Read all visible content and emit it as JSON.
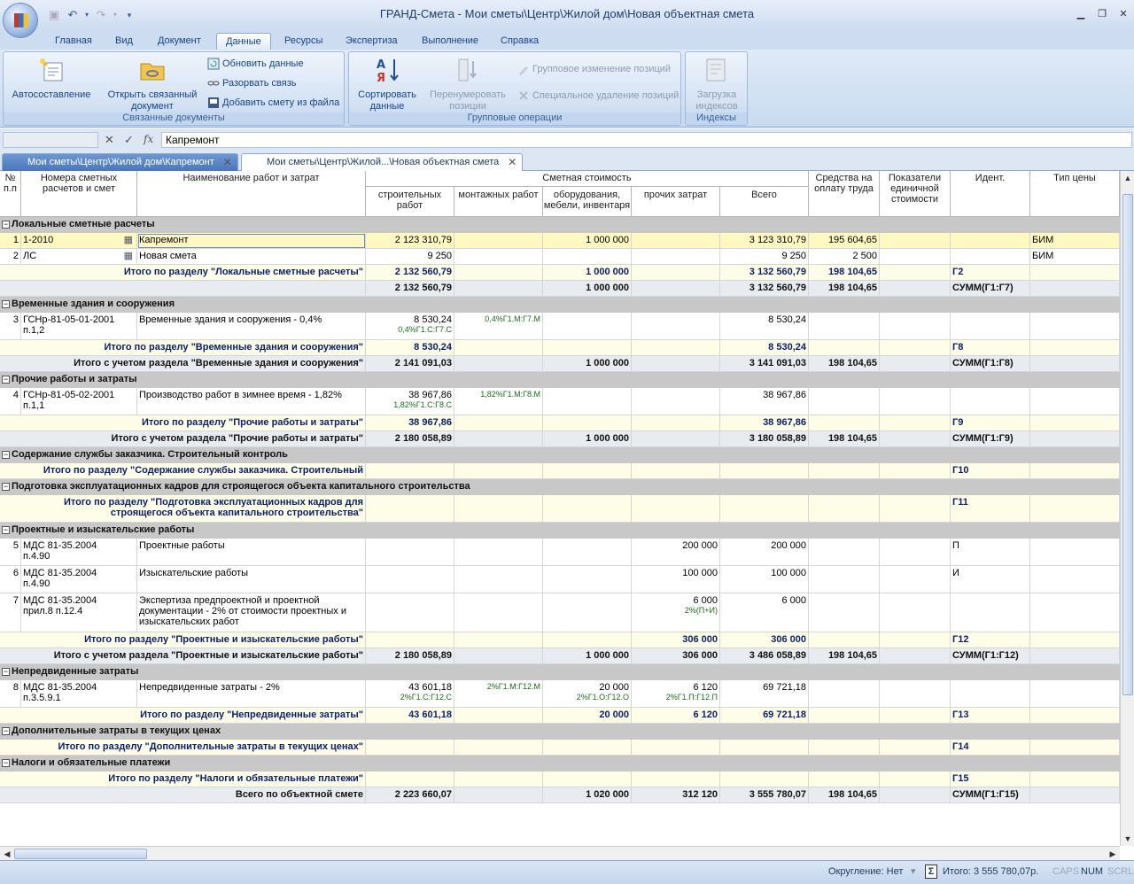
{
  "window": {
    "title": "ГРАНД-Смета - Мои сметы\\Центр\\Жилой дом\\Новая объектная смета"
  },
  "ribbon_tabs": [
    "Главная",
    "Вид",
    "Документ",
    "Данные",
    "Ресурсы",
    "Экспертиза",
    "Выполнение",
    "Справка"
  ],
  "ribbon": {
    "linked": {
      "autocompose": "Автосоставление",
      "open_linked": "Открыть связанный документ",
      "refresh": "Обновить данные",
      "break_link": "Разорвать связь",
      "add_from_file": "Добавить смету из файла",
      "group": "Связанные документы"
    },
    "group_ops": {
      "sort": "Сортировать данные",
      "renumber": "Перенумеровать позиции",
      "group_change": "Групповое изменение позиций",
      "special_delete": "Специальное удаление позиций",
      "group": "Групповые операции"
    },
    "indexes": {
      "load": "Загрузка индексов",
      "group": "Индексы"
    }
  },
  "formula_bar": {
    "name": "",
    "value": "Капремонт"
  },
  "doc_tabs": [
    {
      "label": "Мои сметы\\Центр\\Жилой дом\\Капремонт",
      "active": false
    },
    {
      "label": "Мои сметы\\Центр\\Жилой...\\Новая объектная смета",
      "active": true
    }
  ],
  "headers": {
    "num": "№ п.п",
    "codes": "Номера сметных расчетов и смет",
    "name": "Наименование работ и затрат",
    "cost": "Сметная стоимость",
    "build": "строительных работ",
    "mount": "монтажных работ",
    "equip": "оборудования, мебели, инвентаря",
    "other": "прочих затрат",
    "total": "Всего",
    "labor": "Средства на оплату труда",
    "unit": "Показатели единичной стоимости",
    "ident": "Идент.",
    "price_type": "Тип цены"
  },
  "rows": [
    {
      "kind": "sec",
      "label": "Локальные сметные расчеты"
    },
    {
      "kind": "item",
      "sel": true,
      "num": "1",
      "code": "1-2010",
      "doc": true,
      "name": "Капремонт",
      "build": "2 123 310,79",
      "equip": "1 000 000",
      "total": "3 123 310,79",
      "labor": "195 604,65",
      "ptype": "БИМ"
    },
    {
      "kind": "item",
      "num": "2",
      "code": "ЛС",
      "doc": true,
      "name": "Новая смета",
      "build": "9 250",
      "total": "9 250",
      "labor": "2 500",
      "ptype": "БИМ"
    },
    {
      "kind": "tot",
      "label": "Итого по разделу \"Локальные сметные расчеты\"",
      "build": "2 132 560,79",
      "equip": "1 000 000",
      "total": "3 132 560,79",
      "labor": "198 104,65",
      "ident": "Г2"
    },
    {
      "kind": "tot2",
      "label": "",
      "build": "2 132 560,79",
      "equip": "1 000 000",
      "total": "3 132 560,79",
      "labor": "198 104,65",
      "ident": "СУММ(Г1:Г7)"
    },
    {
      "kind": "sec",
      "label": "Временные здания и сооружения"
    },
    {
      "kind": "item",
      "h": 31,
      "num": "3",
      "code": "ГСНр-81-05-01-2001",
      "code2": "п.1,2",
      "name": "Временные здания и сооружения - 0,4%",
      "build": "8 530,24",
      "build_f": "0,4%Г1.С:Г7.С",
      "mount_f": "0,4%Г1.М:Г7.М",
      "total": "8 530,24"
    },
    {
      "kind": "tot",
      "label": "Итого по разделу \"Временные здания и сооружения\"",
      "build": "8 530,24",
      "total": "8 530,24",
      "ident": "Г8"
    },
    {
      "kind": "tot2",
      "label": "Итого с учетом раздела \"Временные здания и сооружения\"",
      "build": "2 141 091,03",
      "equip": "1 000 000",
      "total": "3 141 091,03",
      "labor": "198 104,65",
      "ident": "СУММ(Г1:Г8)"
    },
    {
      "kind": "sec",
      "label": "Прочие работы и затраты"
    },
    {
      "kind": "item",
      "h": 31,
      "num": "4",
      "code": "ГСНр-81-05-02-2001",
      "code2": "п.1,1",
      "name": "Производство работ в зимнее время - 1,82%",
      "build": "38 967,86",
      "build_f": "1,82%Г1.С:Г8.С",
      "mount_f": "1,82%Г1.М:Г8.М",
      "total": "38 967,86"
    },
    {
      "kind": "tot",
      "label": "Итого по разделу \"Прочие работы и затраты\"",
      "build": "38 967,86",
      "total": "38 967,86",
      "ident": "Г9"
    },
    {
      "kind": "tot2",
      "label": "Итого с учетом раздела \"Прочие работы и затраты\"",
      "build": "2 180 058,89",
      "equip": "1 000 000",
      "total": "3 180 058,89",
      "labor": "198 104,65",
      "ident": "СУММ(Г1:Г9)"
    },
    {
      "kind": "sec",
      "label": "Содержание службы заказчика. Строительный контроль"
    },
    {
      "kind": "tot",
      "label": "Итого по разделу \"Содержание службы заказчика. Строительный",
      "ident": "Г10"
    },
    {
      "kind": "sec",
      "label": "Подготовка эксплуатационных кадров для строящегося объекта капитального строительства"
    },
    {
      "kind": "tot",
      "h": 31,
      "label": "Итого по разделу \"Подготовка эксплуатационных кадров для",
      "label2": "строящегося объекта капитального строительства\"",
      "ident": "Г11"
    },
    {
      "kind": "sec",
      "label": "Проектные и изыскательские работы"
    },
    {
      "kind": "item",
      "h": 31,
      "num": "5",
      "code": "МДС 81-35.2004",
      "code2": "п.4.90",
      "name": "Проектные работы",
      "other": "200 000",
      "total": "200 000",
      "ident": "П"
    },
    {
      "kind": "item",
      "h": 31,
      "num": "6",
      "code": "МДС 81-35.2004",
      "code2": "п.4.90",
      "name": "Изыскательские работы",
      "other": "100 000",
      "total": "100 000",
      "ident": "И"
    },
    {
      "kind": "item",
      "h": 44,
      "num": "7",
      "code": "МДС 81-35.2004",
      "code2": "прил.8 п.12.4",
      "name": "Экспертиза предпроектной и проектной",
      "name2": "документации - 2% от стоимости проектных и",
      "name3": "изыскательских работ",
      "other": "6 000",
      "other_f": "2%(П+И)",
      "total": "6 000"
    },
    {
      "kind": "tot",
      "label": "Итого по разделу \"Проектные и изыскательские работы\"",
      "other": "306 000",
      "total": "306 000",
      "ident": "Г12"
    },
    {
      "kind": "tot2",
      "label": "Итого с учетом раздела \"Проектные и изыскательские работы\"",
      "build": "2 180 058,89",
      "equip": "1 000 000",
      "other": "306 000",
      "total": "3 486 058,89",
      "labor": "198 104,65",
      "ident": "СУММ(Г1:Г12)"
    },
    {
      "kind": "sec",
      "label": "Непредвиденные затраты"
    },
    {
      "kind": "item",
      "h": 31,
      "num": "8",
      "code": "МДС 81-35.2004",
      "code2": "п.3.5.9.1",
      "name": "Непредвиденные затраты - 2%",
      "build": "43 601,18",
      "build_f": "2%Г1.С:Г12.С",
      "mount_f": "2%Г1.М:Г12.М",
      "equip": "20 000",
      "equip_f": "2%Г1.О:Г12.О",
      "other": "6 120",
      "other_f": "2%Г1.П:Г12.П",
      "total": "69 721,18"
    },
    {
      "kind": "tot",
      "label": "Итого по разделу \"Непредвиденные затраты\"",
      "build": "43 601,18",
      "equip": "20 000",
      "other": "6 120",
      "total": "69 721,18",
      "ident": "Г13"
    },
    {
      "kind": "sec",
      "label": "Дополнительные затраты в текущих ценах"
    },
    {
      "kind": "tot",
      "label": "Итого по разделу \"Дополнительные затраты в текущих ценах\"",
      "ident": "Г14"
    },
    {
      "kind": "sec",
      "label": "Налоги и обязательные платежи"
    },
    {
      "kind": "tot",
      "label": "Итого по разделу \"Налоги и обязательные платежи\"",
      "ident": "Г15"
    },
    {
      "kind": "tot2",
      "label": "Всего по объектной смете",
      "build": "2 223 660,07",
      "equip": "1 020 000",
      "other": "312 120",
      "total": "3 555 780,07",
      "labor": "198 104,65",
      "ident": "СУММ(Г1:Г15)"
    }
  ],
  "status": {
    "rounding": "Округление: Нет",
    "sum_icon": "Σ",
    "total": "Итого: 3 555 780,07р.",
    "caps": "CAPS",
    "num": "NUM",
    "scrl": "SCRL"
  }
}
